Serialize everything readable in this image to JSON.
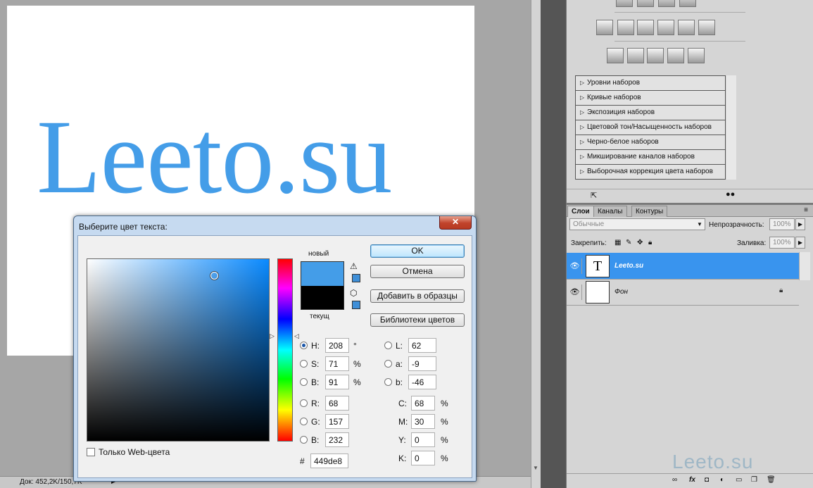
{
  "document": {
    "text": "Leeto.su",
    "status": "Док: 452,2K/150,7K"
  },
  "adjustments": {
    "presets": [
      "Уровни наборов",
      "Кривые наборов",
      "Экспозиция наборов",
      "Цветовой тон/Насыщенность наборов",
      "Черно-белое наборов",
      "Микширование каналов наборов",
      "Выборочная коррекция цвета наборов"
    ]
  },
  "layers_panel": {
    "tabs": [
      "Слои",
      "Каналы",
      "Контуры"
    ],
    "blend_mode": "Обычные",
    "opacity_label": "Непрозрачность:",
    "opacity_value": "100%",
    "lock_label": "Закрепить:",
    "fill_label": "Заливка:",
    "fill_value": "100%",
    "layers": [
      {
        "name": "Leeto.su",
        "thumb": "T",
        "selected": true
      },
      {
        "name": "Фон",
        "thumb": "",
        "selected": false
      }
    ],
    "watermark": "Leeto.su"
  },
  "dialog": {
    "title": "Выберите цвет текста:",
    "close": "✕",
    "label_new": "новый",
    "label_current": "текущ",
    "new_color": "#449de8",
    "current_color": "#000000",
    "buttons": {
      "ok": "OK",
      "cancel": "Отмена",
      "add_swatch": "Добавить в образцы",
      "libraries": "Библиотеки цветов"
    },
    "hsb": {
      "h": "208",
      "s": "71",
      "b": "91",
      "h_unit": "°",
      "s_unit": "%",
      "b_unit": "%"
    },
    "rgb": {
      "r": "68",
      "g": "157",
      "b": "232"
    },
    "lab": {
      "l": "62",
      "a": "-9",
      "b": "-46"
    },
    "cmyk": {
      "c": "68",
      "m": "30",
      "y": "0",
      "k": "0",
      "unit": "%"
    },
    "hex": "449de8",
    "labels": {
      "h": "H:",
      "s": "S:",
      "bb": "B:",
      "r": "R:",
      "g": "G:",
      "b": "B:",
      "l": "L:",
      "a": "a:",
      "lb": "b:",
      "c": "C:",
      "m": "M:",
      "y": "Y:",
      "k": "K:",
      "hash": "#"
    },
    "web_only": "Только Web-цвета"
  }
}
